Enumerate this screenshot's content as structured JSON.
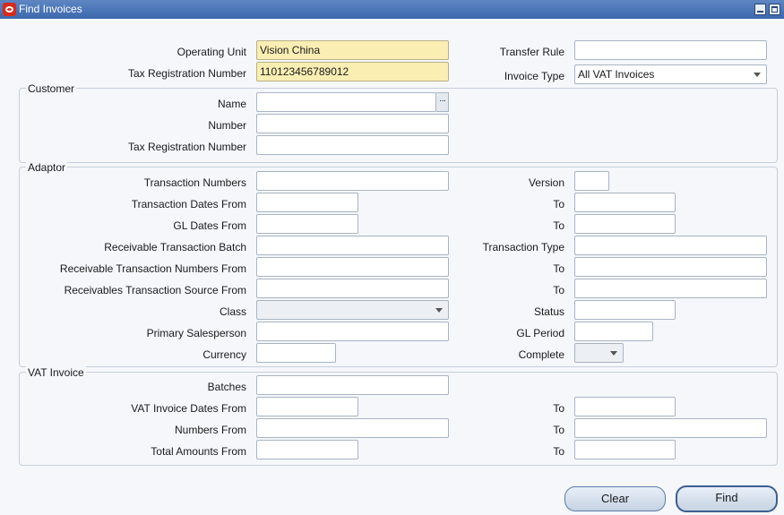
{
  "window": {
    "title": "Find Invoices"
  },
  "top": {
    "operating_unit_label": "Operating Unit",
    "operating_unit_value": "Vision China",
    "tax_reg_label": "Tax Registration Number",
    "tax_reg_value": "110123456789012",
    "transfer_rule_label": "Transfer Rule",
    "transfer_rule_value": "",
    "invoice_type_label": "Invoice Type",
    "invoice_type_value": "All VAT Invoices"
  },
  "customer": {
    "title": "Customer",
    "name_label": "Name",
    "number_label": "Number",
    "tax_reg_label": "Tax Registration Number",
    "lov_glyph": "···"
  },
  "adaptor": {
    "title": "Adaptor",
    "transaction_numbers_label": "Transaction Numbers",
    "version_label": "Version",
    "transaction_dates_from_label": "Transaction Dates From",
    "to_label": "To",
    "gl_dates_from_label": "GL Dates From",
    "receivable_batch_label": "Receivable Transaction Batch",
    "transaction_type_label": "Transaction Type",
    "receivable_numbers_from_label": "Receivable Transaction Numbers From",
    "receivables_source_from_label": "Receivables Transaction Source From",
    "class_label": "Class",
    "status_label": "Status",
    "primary_salesperson_label": "Primary Salesperson",
    "gl_period_label": "GL Period",
    "currency_label": "Currency",
    "complete_label": "Complete"
  },
  "vat": {
    "title": "VAT Invoice",
    "batches_label": "Batches",
    "dates_from_label": "VAT Invoice Dates From",
    "numbers_from_label": "Numbers From",
    "total_amounts_from_label": "Total Amounts From",
    "to_label": "To"
  },
  "buttons": {
    "clear": "Clear",
    "find": "Find"
  },
  "colors": {
    "titlebar": "#3c68ad",
    "required_field": "#fbeeb3",
    "background": "#f5f7fb"
  },
  "icons": {
    "app": "oracle-icon",
    "minimize": "minimize-icon",
    "maximize": "maximize-icon",
    "lov": "ellipsis-icon",
    "dropdown": "chevron-down-icon"
  }
}
